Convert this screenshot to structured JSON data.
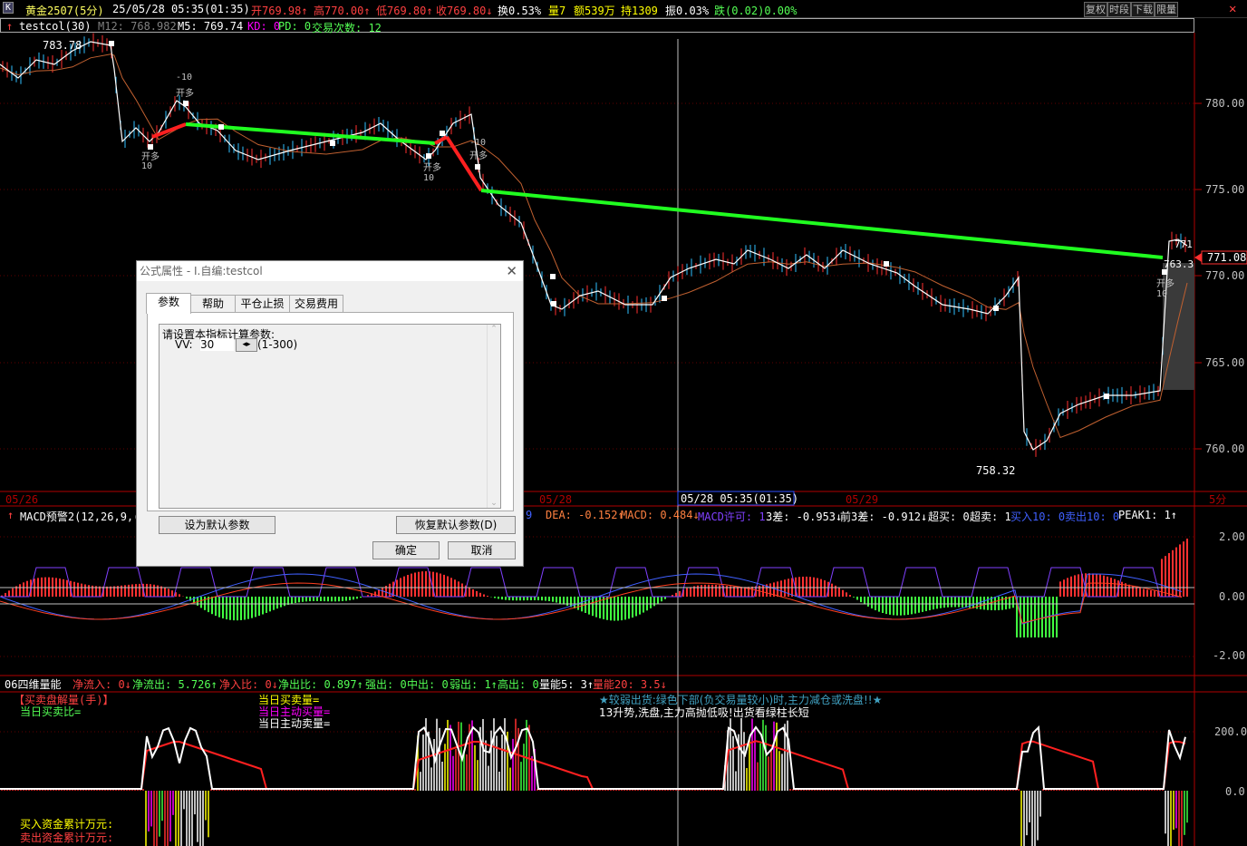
{
  "topbar": {
    "logo": "K",
    "symbol": "黄金2507(5分)",
    "datetime": "25/05/28 05:35(01:35)",
    "open": "开769.98↑",
    "high": "高770.00↑",
    "low": "低769.80↑",
    "close": "收769.80↓",
    "turnover": "换0.53%",
    "volume": "量7",
    "amount": "额539万",
    "hold": "持1309",
    "amplitude": "振0.03%",
    "change": "跌(0.02)0.00%",
    "buttons": [
      "复权",
      "时段",
      "下载",
      "限量"
    ],
    "close_icon": "✕"
  },
  "indicator_line": {
    "name": "testcol(30)",
    "m12": "M12: 768.982",
    "m5": "M5: 769.74",
    "kd": "KD: 0",
    "pd": "PD: 0",
    "trades": "交易次数: 12"
  },
  "price_axis": {
    "ticks": [
      "780.00",
      "775.00",
      "770.00",
      "765.00",
      "760.00"
    ],
    "current": "771.08",
    "high_label": "783.78",
    "low_label": "758.32",
    "right_top_label": "771",
    "right_mid_label": "763.3"
  },
  "markers": {
    "buy_short": "开多",
    "qty_pos": "10",
    "qty_neg": "-10"
  },
  "time_axis": {
    "labels": [
      "05/26",
      "05/28",
      "05/28 05:35(01:35)",
      "05/29",
      "5分"
    ]
  },
  "macd_line": {
    "name": "MACD预警2(12,26,9,(",
    "dif_tail": "9",
    "dea": "DEA: -0.152↑",
    "macd": "MACD: 0.484↓",
    "permit": "MACD许可: 1",
    "diff3": "3差: -0.953↓",
    "prev3": "前3差: -0.912↓",
    "over_buy": "超买: 0",
    "over_sell": "超卖: 1",
    "buy10": "买入10: 0",
    "sell10": "卖出10: 0",
    "peak": "PEAK1: 1↑",
    "ticks": [
      "2.00",
      "0.00",
      "-2.00"
    ]
  },
  "vol_line": {
    "name": "06四维量能",
    "net_in": "净流入: 0↓",
    "net_out": "净流出: 5.726↑",
    "net_in_ratio": "净入比: 0↓",
    "net_out_ratio": "净出比: 0.897↑",
    "strong_out": "强出: 0",
    "mid_out": "中出: 0",
    "weak_out": "弱出: 1↑",
    "high_out": "高出: 0",
    "vol_energy": "量能5: 3↑",
    "vol20": "量能20: 3.5↓",
    "ticks": [
      "200.0",
      "0.0"
    ]
  },
  "vol_legend": {
    "l1": "【买卖盘解量(手)】",
    "l2": "当日买卖比=",
    "l3": "当日买卖量=",
    "l4": "当日主动买量=",
    "l5": "当日主动卖量=",
    "note1": "★较弱出货:绿色下部(负交易量较小)时,主力减仓或洗盘!!★",
    "note2": "13升势,洗盘,主力高抛低吸!出货看绿柱长短",
    "bottom1": "买入资金累计万元:",
    "bottom2": "卖出资金累计万元:"
  },
  "dialog": {
    "title": "公式属性 - I.自编:testcol",
    "close": "✕",
    "tabs": [
      "参数",
      "帮助",
      "平仓止损",
      "交易费用"
    ],
    "param_title": "请设置本指标计算参数:",
    "param_name": "VV:",
    "param_value": "30",
    "param_range": "(1-300)",
    "btn_set_default": "设为默认参数",
    "btn_restore_default": "恢复默认参数(D)",
    "btn_ok": "确定",
    "btn_cancel": "取消"
  },
  "colors": {
    "up": "#ff3232",
    "down": "#54ff54",
    "white": "#ffffff",
    "yellow": "#ffff00",
    "magenta": "#ff00ff",
    "cyan": "#00ffff",
    "orange": "#ff8040",
    "axis_red": "#b00000"
  }
}
